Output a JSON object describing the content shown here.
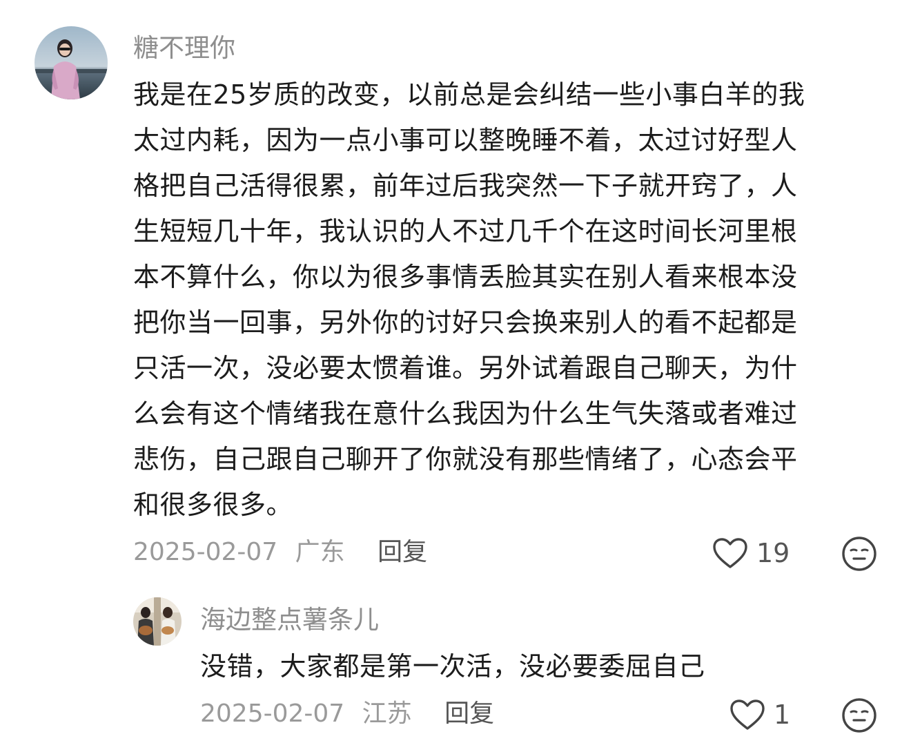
{
  "comments": {
    "main": {
      "username": "糖不理你",
      "lines": [
        "我是在25岁质的改变，以前总是会纠结一些小事白羊的我",
        "太过内耗，因为一点小事可以整晚睡不着，太过讨好型人",
        "格把自己活得很累，前年过后我突然一下子就开窍了，人",
        "生短短几十年，我认识的人不过几千个在这时间长河里根",
        "本不算什么，你以为很多事情丢脸其实在别人看来根本没",
        "把你当一回事，另外你的讨好只会换来别人的看不起都是",
        "只活一次，没必要太惯着谁。另外试着跟自己聊天，为什",
        "么会有这个情绪我在意什么我因为什么生气失落或者难过",
        "悲伤，自己跟自己聊开了你就没有那些情绪了，心态会平",
        "和很多很多。"
      ],
      "date": "2025-02-07",
      "location": "广东",
      "reply_label": "回复",
      "like_count": "19",
      "like_icon": "heart-outline-icon",
      "react_icon": "neutral-face-icon"
    },
    "reply": {
      "username": "海边整点薯条儿",
      "text": "没错，大家都是第一次活，没必要委屈自己",
      "date": "2025-02-07",
      "location": "江苏",
      "reply_label": "回复",
      "like_count": "1",
      "like_icon": "heart-outline-icon",
      "react_icon": "neutral-face-icon"
    }
  },
  "colors": {
    "username": "#8e8e8e",
    "text": "#1c1c1c",
    "meta": "#9a9a9a",
    "icon": "#444444"
  }
}
